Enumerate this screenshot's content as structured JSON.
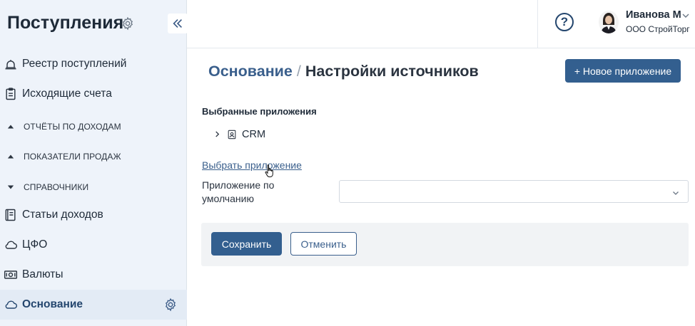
{
  "sidebar": {
    "title": "Поступления",
    "items": [
      {
        "label": "Реестр поступлений",
        "icon": "bell-icon"
      },
      {
        "label": "Исходящие счета",
        "icon": "clipboard-icon"
      },
      {
        "label": "ОТЧЁТЫ ПО ДОХОДАМ",
        "icon": "caret-up-icon"
      },
      {
        "label": "ПОКАЗАТЕЛИ ПРОДАЖ",
        "icon": "caret-up-icon"
      },
      {
        "label": "СПРАВОЧНИКИ",
        "icon": "caret-down-icon"
      },
      {
        "label": "Статьи доходов",
        "icon": "book-icon"
      },
      {
        "label": "ЦФО",
        "icon": "cloud-icon"
      },
      {
        "label": "Валюты",
        "icon": "banknote-icon"
      },
      {
        "label": "Основание",
        "icon": "cloud-icon",
        "active": true
      }
    ]
  },
  "topbar": {
    "help": "?",
    "user_name": "Иванова М",
    "user_org": "ООО СтройТорг"
  },
  "main": {
    "breadcrumb_link": "Основание",
    "breadcrumb_sep": "/",
    "breadcrumb_current": "Настройки источников",
    "new_app_button": "+ Новое приложение",
    "selected_apps_title": "Выбранные приложения",
    "selected_apps": [
      {
        "label": "CRM"
      }
    ],
    "choose_app_link": "Выбрать приложение",
    "default_app_label": "Приложение по умолчанию",
    "default_app_value": "",
    "save_button": "Сохранить",
    "cancel_button": "Отменить"
  },
  "colors": {
    "accent": "#335f8f",
    "sidebar_bg": "#eef3fa",
    "link": "#3a5f8c"
  }
}
